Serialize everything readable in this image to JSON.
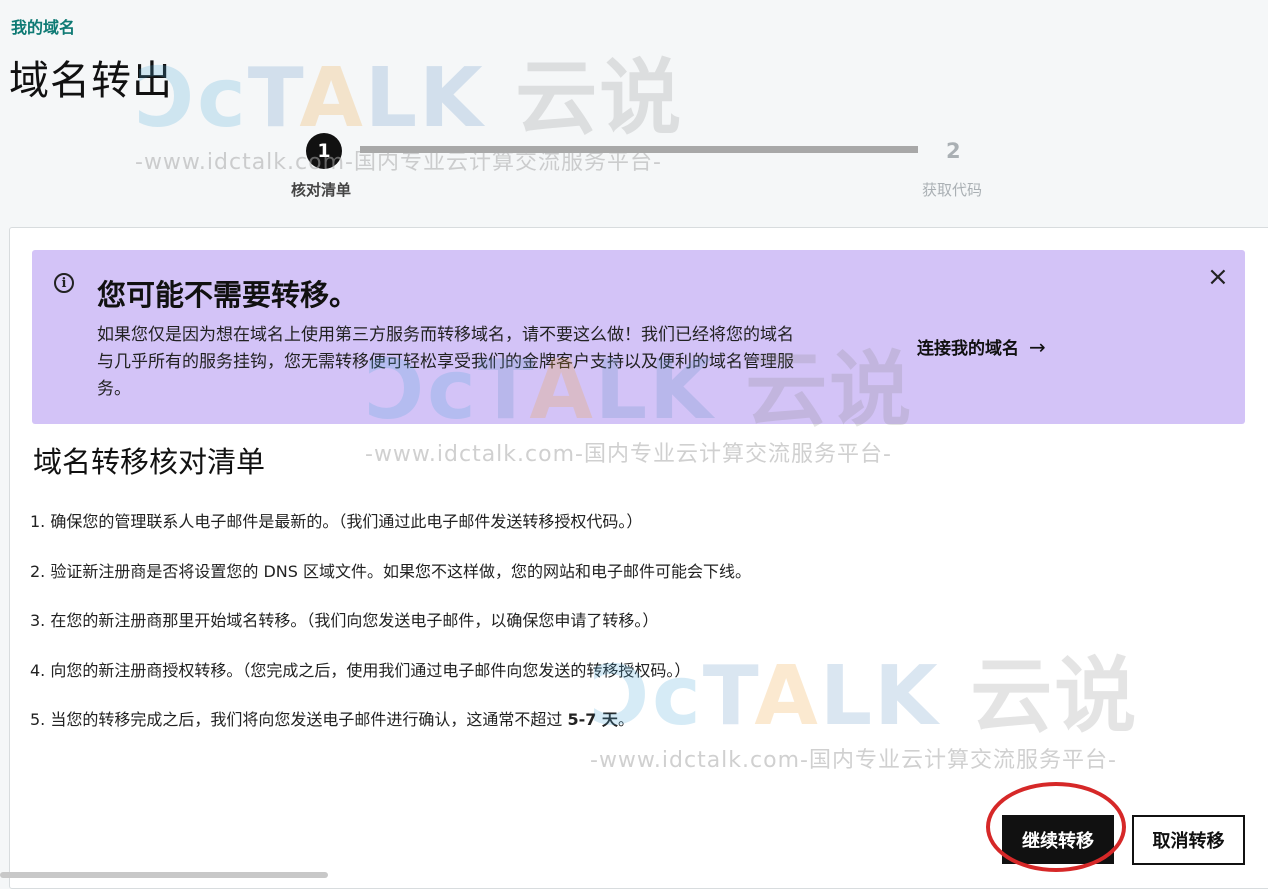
{
  "header": {
    "breadcrumb": "我的域名",
    "title": "域名转出"
  },
  "stepper": {
    "step1_number": "1",
    "step1_label": "核对清单",
    "step2_number": "2",
    "step2_label": "获取代码"
  },
  "banner": {
    "title": "您可能不需要转移。",
    "body": "如果您仅是因为想在域名上使用第三方服务而转移域名，请不要这么做！我们已经将您的域名与几乎所有的服务挂钩，您无需转移便可轻松享受我们的金牌客户支持以及便利的域名管理服务。",
    "link_label": "连接我的域名",
    "link_arrow": "→",
    "info_icon": "i",
    "close_icon": "×",
    "background": "#d3c3f7"
  },
  "checklist": {
    "title": "域名转移核对清单",
    "items": [
      "1. 确保您的管理联系人电子邮件是最新的。（我们通过此电子邮件发送转移授权代码。）",
      "2. 验证新注册商是否将设置您的 DNS 区域文件。如果您不这样做，您的网站和电子邮件可能会下线。",
      "3. 在您的新注册商那里开始域名转移。（我们向您发送电子邮件，以确保您申请了转移。）",
      "4. 向您的新注册商授权转移。（您完成之后，使用我们通过电子邮件向您发送的转移授权码。）"
    ],
    "item5_prefix": "5. 当您的转移完成之后，我们将向您发送电子邮件进行确认，这通常不超过 ",
    "item5_emphasis": "5-7 天",
    "item5_suffix": "。"
  },
  "actions": {
    "continue_label": "继续转移",
    "cancel_label": "取消转移",
    "highlight_color": "#d62828"
  },
  "watermark": {
    "logo_a": "Ɔc",
    "logo_t": "T",
    "logo_a2": "A",
    "logo_lk": "LK",
    "logo_cn": "云说",
    "tagline": "-www.idctalk.com-国内专业云计算交流服务平台-"
  },
  "colors": {
    "accent": "#0e7a74",
    "primary_button": "#111111"
  }
}
